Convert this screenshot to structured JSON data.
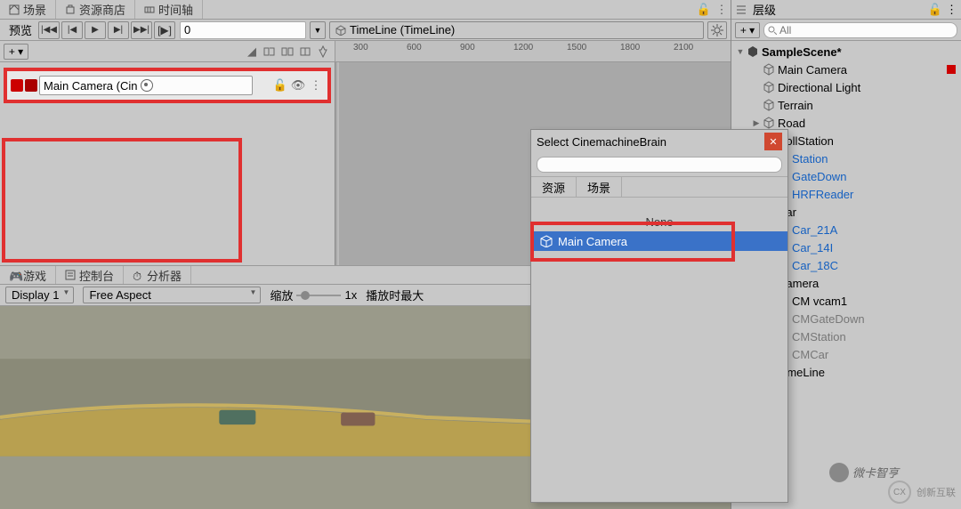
{
  "tabs": {
    "scene": "场景",
    "assetstore": "资源商店",
    "timeline": "时间轴"
  },
  "preview": {
    "label": "预览",
    "frame": "0"
  },
  "timeline_dd": "TimeLine (TimeLine)",
  "ruler": [
    "300",
    "600",
    "900",
    "1200",
    "1500",
    "1800",
    "2100"
  ],
  "track": {
    "label": "Main Camera (Cin"
  },
  "game_tabs": {
    "game": "游戏",
    "console": "控制台",
    "profiler": "分析器"
  },
  "game_ctrl": {
    "display": "Display 1",
    "aspect": "Free Aspect",
    "scale_lbl": "缩放",
    "scale_val": "1x",
    "maxplay": "播放时最大"
  },
  "hierarchy": {
    "title": "层级",
    "search": "All",
    "scene": "SampleScene*",
    "items": [
      {
        "lbl": "Main Camera",
        "indent": 1,
        "ic": "gray",
        "cl": "",
        "tog": "",
        "extra": "brain"
      },
      {
        "lbl": "Directional Light",
        "indent": 1,
        "ic": "gray",
        "cl": "",
        "tog": ""
      },
      {
        "lbl": "Terrain",
        "indent": 1,
        "ic": "gray",
        "cl": "",
        "tog": ""
      },
      {
        "lbl": "Road",
        "indent": 1,
        "ic": "gray",
        "cl": "",
        "tog": "▶"
      },
      {
        "lbl": "DollStation",
        "indent": 1,
        "ic": "gray",
        "cl": "",
        "tog": "▼"
      },
      {
        "lbl": "Station",
        "indent": 2,
        "ic": "blue",
        "cl": "blue",
        "tog": "▶"
      },
      {
        "lbl": "GateDown",
        "indent": 2,
        "ic": "blue",
        "cl": "blue",
        "tog": "▶"
      },
      {
        "lbl": "HRFReader",
        "indent": 2,
        "ic": "blue",
        "cl": "blue",
        "tog": "▶"
      },
      {
        "lbl": "Car",
        "indent": 1,
        "ic": "gray",
        "cl": "",
        "tog": "▼"
      },
      {
        "lbl": "Car_21A",
        "indent": 2,
        "ic": "blue",
        "cl": "blue",
        "tog": "▶"
      },
      {
        "lbl": "Car_14I",
        "indent": 2,
        "ic": "blue",
        "cl": "blue",
        "tog": "▶"
      },
      {
        "lbl": "Car_18C",
        "indent": 2,
        "ic": "blue",
        "cl": "blue",
        "tog": "▶"
      },
      {
        "lbl": "Camera",
        "indent": 1,
        "ic": "gray",
        "cl": "",
        "tog": "▼"
      },
      {
        "lbl": "CM vcam1",
        "indent": 2,
        "ic": "gray",
        "cl": "",
        "tog": ""
      },
      {
        "lbl": "CMGateDown",
        "indent": 2,
        "ic": "gray",
        "cl": "gray",
        "tog": ""
      },
      {
        "lbl": "CMStation",
        "indent": 2,
        "ic": "gray",
        "cl": "gray",
        "tog": ""
      },
      {
        "lbl": "CMCar",
        "indent": 2,
        "ic": "gray",
        "cl": "gray",
        "tog": ""
      },
      {
        "lbl": "TimeLine",
        "indent": 1,
        "ic": "gray",
        "cl": "",
        "tog": ""
      }
    ]
  },
  "popup": {
    "title": "Select CinemachineBrain",
    "tabs": {
      "assets": "资源",
      "scene": "场景"
    },
    "none": "None",
    "item": "Main Camera"
  },
  "watermark": {
    "wc": "微卡智亨",
    "cx": "创新互联"
  }
}
